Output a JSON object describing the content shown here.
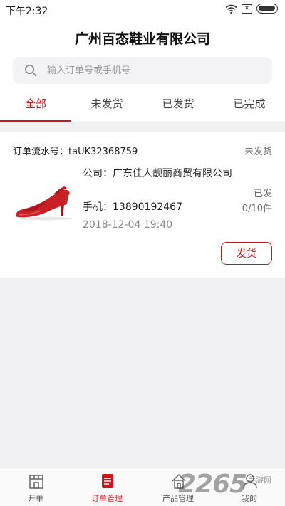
{
  "status_bar": {
    "time": "下午2:32",
    "sim_icon": "✕"
  },
  "header": {
    "title": "广州百态鞋业有限公司"
  },
  "search": {
    "placeholder": "输入订单号或手机号",
    "value": ""
  },
  "tabs": [
    {
      "label": "全部",
      "active": true
    },
    {
      "label": "未发货",
      "active": false
    },
    {
      "label": "已发货",
      "active": false
    },
    {
      "label": "已完成",
      "active": false
    }
  ],
  "order": {
    "number_text": "订单流水号：taUK32368759",
    "status": "未发货",
    "company": "公司：广东佳人靓丽商贸有限公司",
    "phone": "手机：13890192467",
    "date": "2018-12-04 19:40",
    "shipped_label": "已发",
    "shipped_count": "0/10件",
    "ship_button": "发货"
  },
  "bottom_nav": [
    {
      "label": "开单",
      "icon": "storefront-icon",
      "active": false
    },
    {
      "label": "订单管理",
      "icon": "order-list-icon",
      "active": true
    },
    {
      "label": "产品管理",
      "icon": "house-icon",
      "active": false
    },
    {
      "label": "我的",
      "icon": "user-icon",
      "active": false
    }
  ],
  "watermark": {
    "number": "2265",
    "text": "手游网"
  },
  "colors": {
    "accent": "#c8161d",
    "background": "#f1f1f4"
  }
}
